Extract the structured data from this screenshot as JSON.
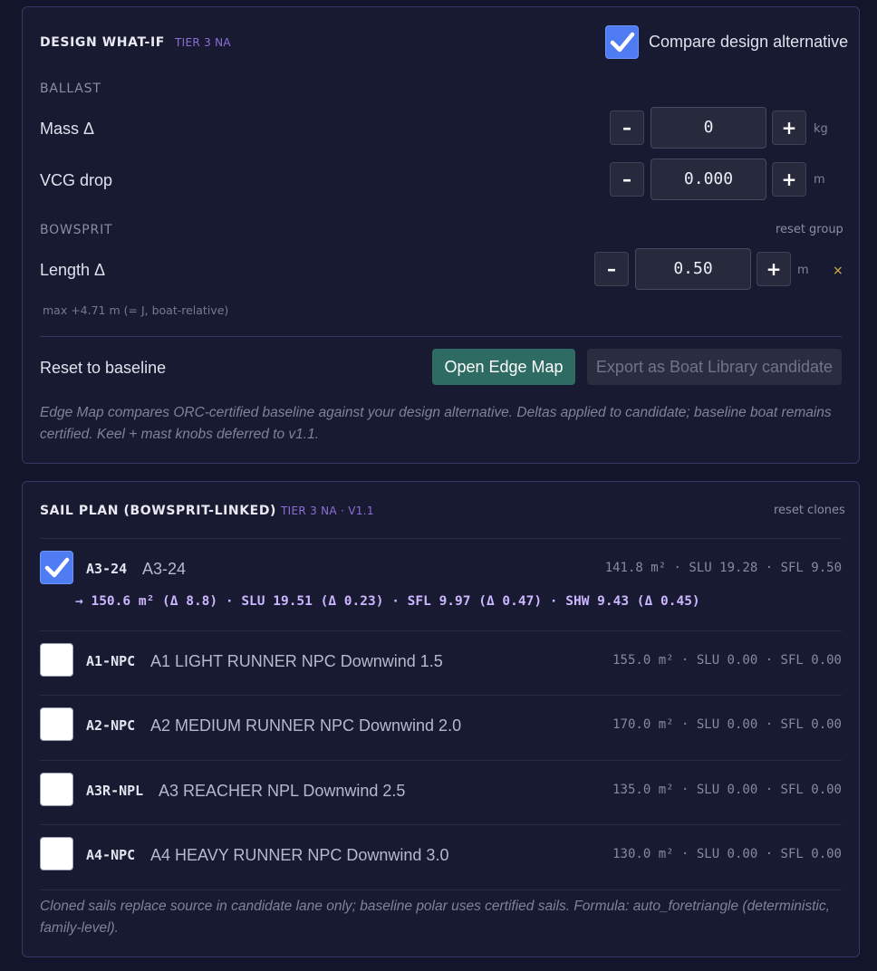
{
  "design_whatif": {
    "title": "DESIGN WHAT-IF",
    "tier": "TIER 3 NA",
    "compare": {
      "label": "Compare design alternative",
      "checked": true
    },
    "ballast": {
      "label": "BALLAST",
      "mass": {
        "label": "Mass Δ",
        "value": "0",
        "unit": "kg",
        "minus": "–",
        "plus": "+"
      },
      "vcg": {
        "label": "VCG drop",
        "value": "0.000",
        "unit": "m",
        "minus": "–",
        "plus": "+"
      }
    },
    "bowsprit": {
      "label": "BOWSPRIT",
      "reset_group": "reset group",
      "length": {
        "label": "Length Δ",
        "value": "0.50",
        "unit": "m",
        "minus": "–",
        "plus": "+",
        "clear": "×"
      },
      "hint": "max +4.71 m (= J, boat-relative)"
    },
    "reset_baseline": "Reset to baseline",
    "open_edge_map": "Open Edge Map",
    "export_candidate": "Export as Boat Library candidate",
    "note": "Edge Map compares ORC-certified baseline against your design alternative. Deltas applied to candidate; baseline boat remains certified. Keel + mast knobs deferred to v1.1."
  },
  "sail_plan": {
    "title": "SAIL PLAN (BOWSPRIT-LINKED)",
    "tier": "TIER 3 NA · V1.1",
    "reset_clones": "reset clones",
    "sails": [
      {
        "code": "A3-24",
        "name": "A3-24",
        "checked": true,
        "stats": "141.8 m² · SLU 19.28 · SFL 9.50",
        "derived": "→ 150.6 m² (Δ 8.8) · SLU 19.51 (Δ 0.23) · SFL 9.97 (Δ 0.47) · SHW 9.43 (Δ 0.45)"
      },
      {
        "code": "A1-NPC",
        "name": "A1 LIGHT RUNNER NPC Downwind 1.5",
        "checked": false,
        "stats": "155.0 m² · SLU 0.00 · SFL 0.00"
      },
      {
        "code": "A2-NPC",
        "name": "A2 MEDIUM RUNNER NPC Downwind 2.0",
        "checked": false,
        "stats": "170.0 m² · SLU 0.00 · SFL 0.00"
      },
      {
        "code": "A3R-NPL",
        "name": "A3 REACHER NPL Downwind 2.5",
        "checked": false,
        "stats": "135.0 m² · SLU 0.00 · SFL 0.00"
      },
      {
        "code": "A4-NPC",
        "name": "A4 HEAVY RUNNER NPC Downwind 3.0",
        "checked": false,
        "stats": "130.0 m² · SLU 0.00 · SFL 0.00"
      }
    ],
    "note": "Cloned sails replace source in candidate lane only; baseline polar uses certified sails. Formula: auto_foretriangle (deterministic, family-level)."
  },
  "colors": {
    "background": "#13162a",
    "panel": "#181a31",
    "accent_purple": "#8c6fd6",
    "checkbox_blue": "#4f7cf3",
    "primary_button": "#2e6b62",
    "derived_text": "#cbb6ff"
  }
}
